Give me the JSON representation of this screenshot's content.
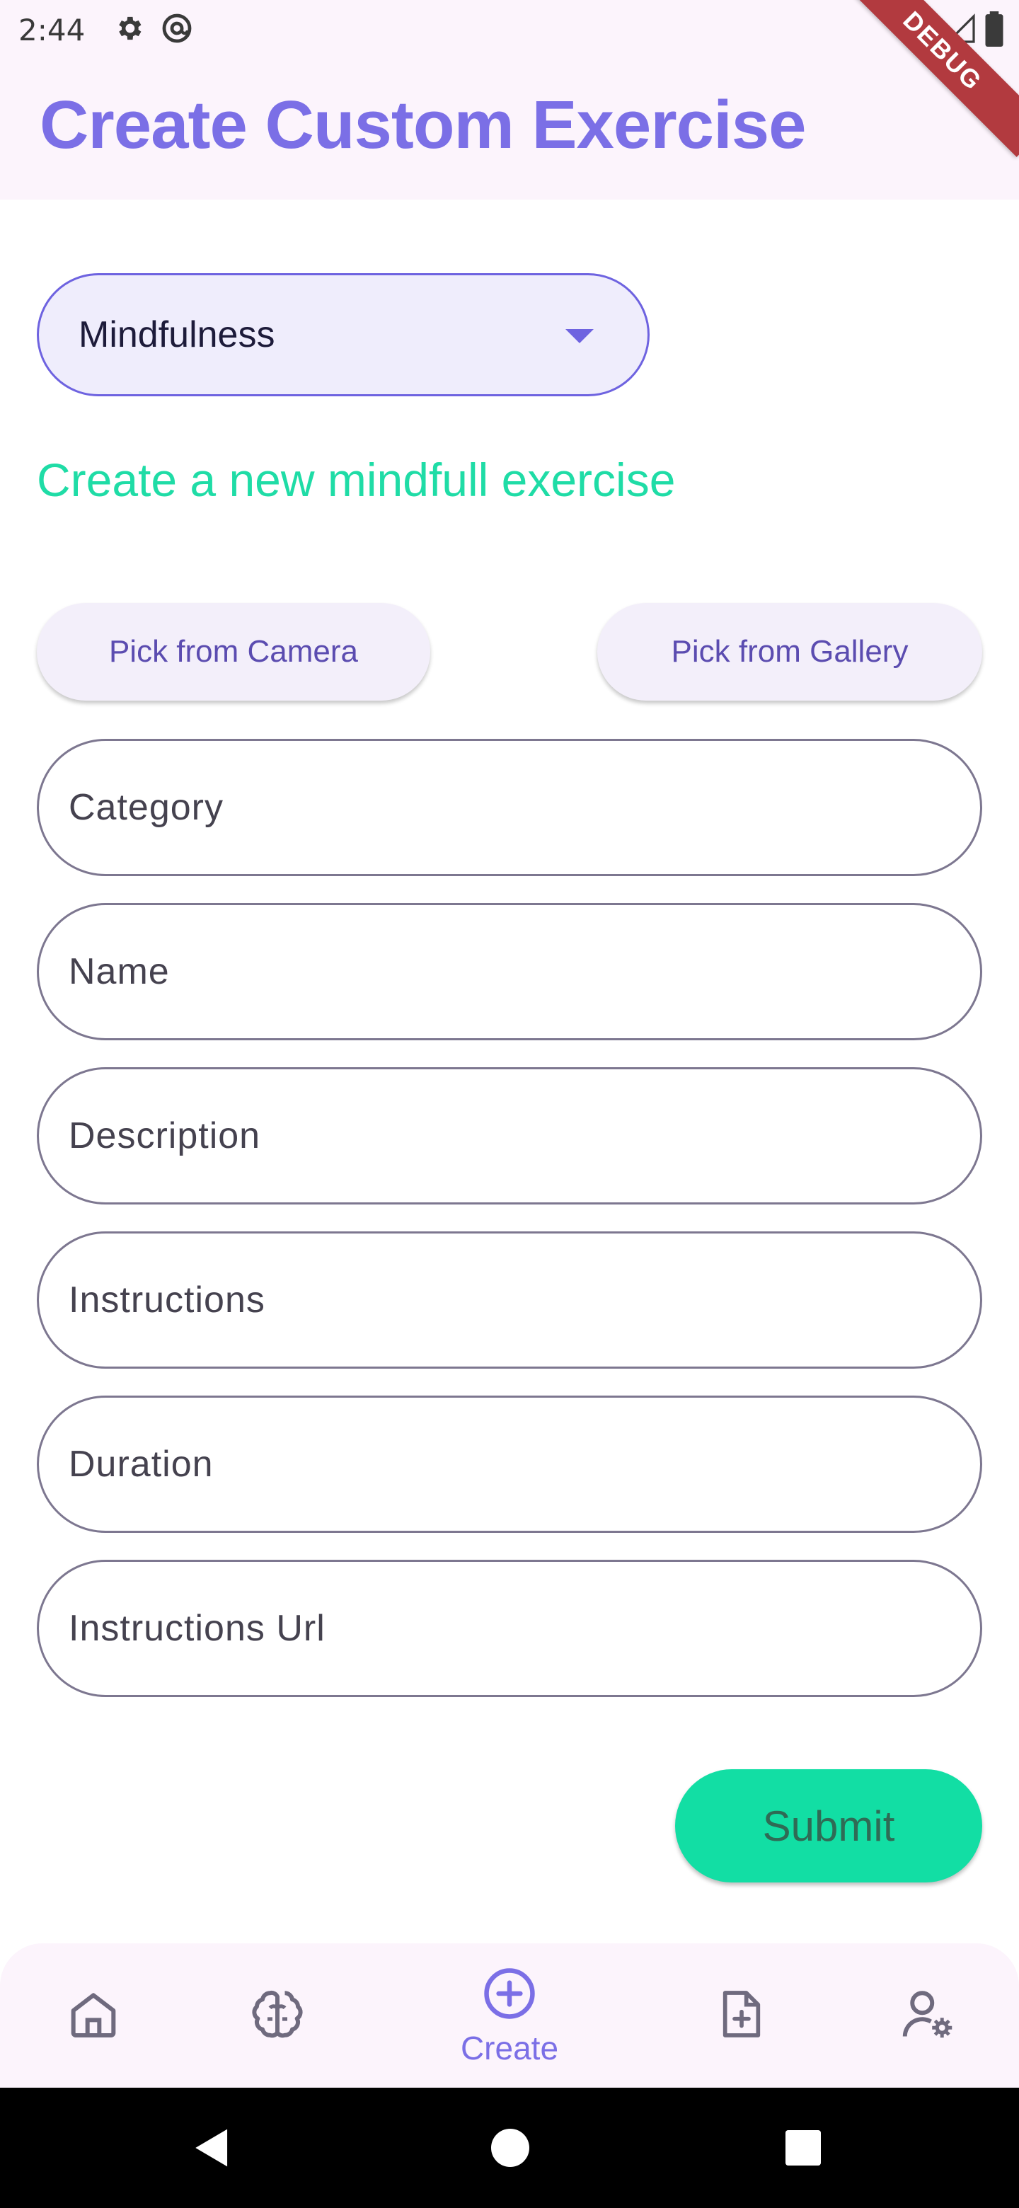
{
  "status_bar": {
    "time": "2:44",
    "icons_left": [
      "settings-icon",
      "at-sign-icon"
    ],
    "icons_right": [
      "wifi-icon",
      "signal-icon",
      "battery-icon"
    ]
  },
  "debug_ribbon": "DEBUG",
  "app_bar": {
    "title": "Create Custom Exercise"
  },
  "dropdown": {
    "selected": "Mindfulness"
  },
  "subtitle": "Create a new mindfull exercise",
  "image_pickers": {
    "camera_label": "Pick from Camera",
    "gallery_label": "Pick from Gallery"
  },
  "fields": {
    "category": "Category",
    "name": "Name",
    "description": "Description",
    "instructions": "Instructions",
    "duration": "Duration",
    "instructions_url": "Instructions Url"
  },
  "submit_label": "Submit",
  "bottom_nav": {
    "items": [
      {
        "icon": "home-icon",
        "label": ""
      },
      {
        "icon": "brain-icon",
        "label": ""
      },
      {
        "icon": "add-circle-icon",
        "label": "Create"
      },
      {
        "icon": "add-document-icon",
        "label": ""
      },
      {
        "icon": "user-settings-icon",
        "label": ""
      }
    ]
  },
  "colors": {
    "accent": "#7b6fe6",
    "green": "#12dea4",
    "subtitle_green": "#1fdca6",
    "app_bar_bg": "#fcf4fc"
  }
}
